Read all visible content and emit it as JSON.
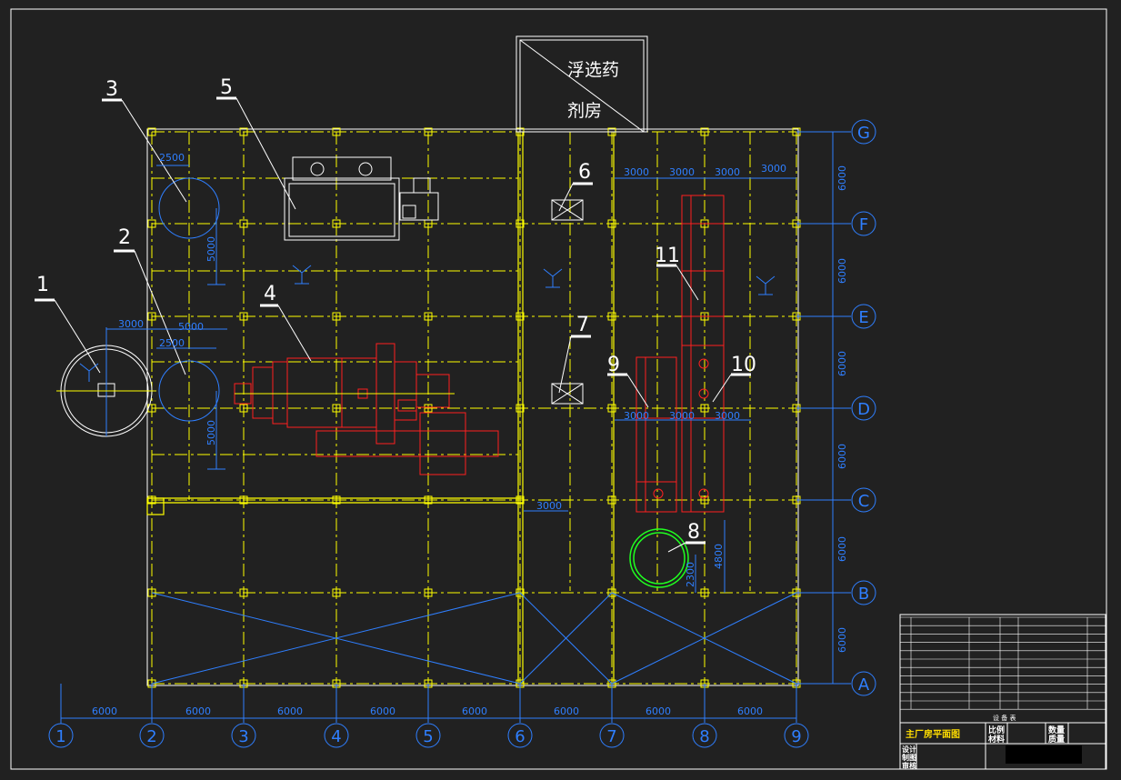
{
  "drawing": {
    "room_label_line1": "浮选药",
    "room_label_line2": "剂房",
    "equipment_labels": [
      "1",
      "2",
      "3",
      "4",
      "5",
      "6",
      "7",
      "8",
      "9",
      "10",
      "11"
    ],
    "row_axes": [
      "G",
      "F",
      "E",
      "D",
      "C",
      "B",
      "A"
    ],
    "col_axes": [
      "1",
      "2",
      "3",
      "4",
      "5",
      "6",
      "7",
      "8",
      "9"
    ],
    "bottom_dims": [
      "6000",
      "6000",
      "6000",
      "6000",
      "6000",
      "6000",
      "6000",
      "6000"
    ],
    "right_dims": [
      "6000",
      "6000",
      "6000",
      "6000",
      "6000",
      "6000"
    ],
    "top_right_dims": [
      "3000",
      "3000",
      "3000",
      "3000"
    ],
    "mid_right_dims": [
      "3000",
      "3000",
      "3000"
    ],
    "dim_2500_a": "2500",
    "dim_2500_b": "2500",
    "dim_5000_v1": "5000",
    "dim_5000_v2": "5000",
    "dim_3000_left": "3000",
    "dim_5000_h": "5000",
    "dim_3000_c": "3000",
    "dim_4800": "4800",
    "dim_2300": "2300"
  },
  "title_block": {
    "table_caption": "设 备 表",
    "drawing_title": "主厂房平面图",
    "ratio_label": "比例",
    "qty_label": "数量",
    "material_label": "材料",
    "weight_label": "质量",
    "designer_label": "设计",
    "drafter_label": "制图",
    "checker_label": "审核"
  },
  "colors": {
    "background": "#212121",
    "grid_yellow": "#ffff00",
    "dimension_blue": "#2f7fff",
    "equipment_red": "#ff2020",
    "equipment_green": "#20ff20",
    "line_white": "#ffffff"
  }
}
